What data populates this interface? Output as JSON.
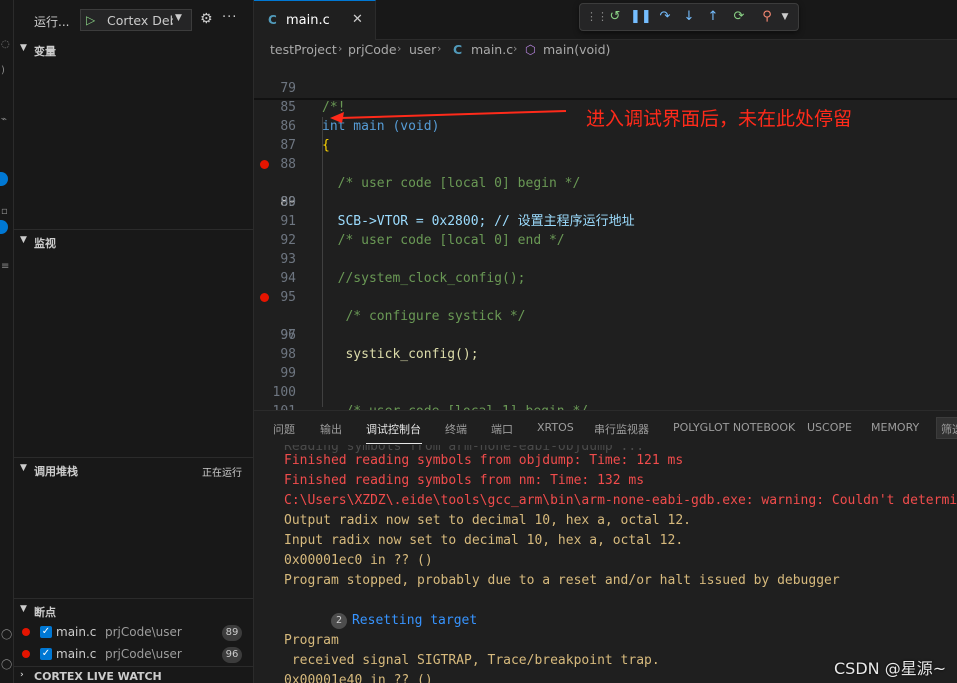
{
  "sidebar": {
    "run_label": "运行...",
    "config_name": "Cortex Debug",
    "sections": {
      "variables": "变量",
      "watch": "监视",
      "callstack": "调用堆栈",
      "callstack_status": "正在运行",
      "breakpoints": "断点",
      "live_watch": "CORTEX LIVE WATCH"
    },
    "breakpoints": [
      {
        "file": "main.c",
        "path": "prjCode\\user",
        "line": "89"
      },
      {
        "file": "main.c",
        "path": "prjCode\\user",
        "line": "96"
      }
    ]
  },
  "editor": {
    "tab": {
      "icon": "C",
      "name": "main.c"
    },
    "breadcrumb": [
      "testProject",
      "prjCode",
      "user",
      "main.c",
      "main(void)"
    ],
    "annotation": "进入调试界面后，未在此处停留",
    "lines": [
      {
        "n": "79",
        "text": "/*!"
      },
      {
        "n": "85",
        "text": "int main (void)"
      },
      {
        "n": "86",
        "text": "{"
      },
      {
        "n": "87",
        "text": ""
      },
      {
        "n": "88",
        "text": "  /* user code [local 0] begin */"
      },
      {
        "n": "89",
        "text": "  SCB->VTOR = 0x2800; // 设置主程序运行地址"
      },
      {
        "n": "90",
        "text": ""
      },
      {
        "n": "91",
        "text": "  /* user code [local 0] end */"
      },
      {
        "n": "92",
        "text": ""
      },
      {
        "n": "93",
        "text": "  //system_clock_config();"
      },
      {
        "n": "94",
        "text": ""
      },
      {
        "n": "95",
        "text": "   /* configure systick */"
      },
      {
        "n": "96",
        "text": "   systick_config();"
      },
      {
        "n": "97",
        "text": ""
      },
      {
        "n": "98",
        "text": ""
      },
      {
        "n": "99",
        "text": ""
      },
      {
        "n": "100",
        "text": "   /* user code [local 1] begin */"
      },
      {
        "n": "101",
        "text": ""
      }
    ]
  },
  "panel": {
    "tabs": [
      "问题",
      "输出",
      "调试控制台",
      "终端",
      "端口",
      "XRTOS",
      "串行监视器",
      "POLYGLOT NOTEBOOK",
      "USCOPE",
      "MEMORY"
    ],
    "filter_label": "筛选",
    "output": [
      {
        "text": "Finished reading symbols from objdump: Time: 121 ms"
      },
      {
        "text": "Finished reading symbols from nm: Time: 132 ms"
      },
      {
        "text": "C:\\Users\\XZDZ\\.eide\\tools\\gcc_arm\\bin\\arm-none-eabi-gdb.exe: warning: Couldn't determine"
      },
      {
        "text": "Output radix now set to decimal 10, hex a, octal 12."
      },
      {
        "text": "Input radix now set to decimal 10, hex a, octal 12."
      },
      {
        "text": "0x00001ec0 in ?? ()"
      },
      {
        "text": "Program stopped, probably due to a reset and/or halt issued by debugger"
      },
      {
        "text": "Resetting target",
        "count": "2"
      },
      {
        "text": ""
      },
      {
        "text": "Program"
      },
      {
        "text": " received signal SIGTRAP, Trace/breakpoint trap."
      },
      {
        "text": "0x00001e40 in ?? ()"
      }
    ]
  },
  "watermark": "CSDN @星源~"
}
